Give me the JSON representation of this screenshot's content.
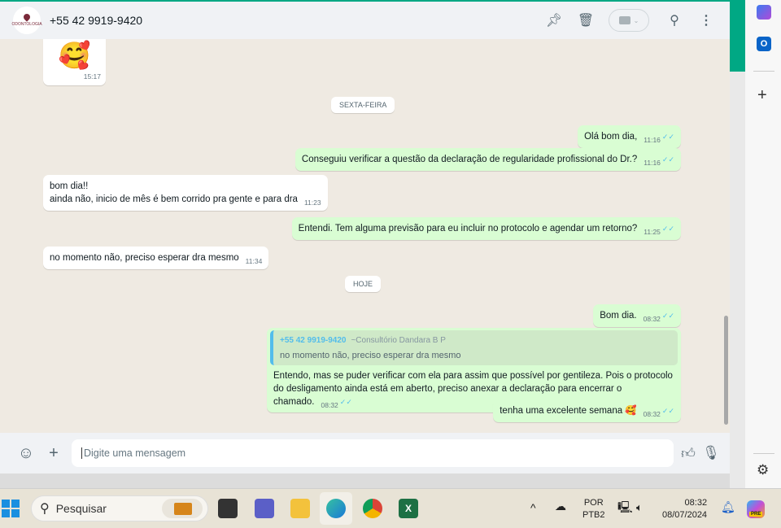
{
  "header": {
    "contact": "+55 42 9919-9420",
    "avatar_text": "ODONTOLOGIA",
    "icons": [
      "pin-icon",
      "trash-icon",
      "video-call-icon",
      "search-icon",
      "menu-icon"
    ]
  },
  "messages": [
    {
      "dir": "in",
      "text": "🥰",
      "time": "15:17"
    },
    {
      "type": "day",
      "text": "SEXTA-FEIRA"
    },
    {
      "dir": "out",
      "text": "Olá bom dia,",
      "time": "11:16"
    },
    {
      "dir": "out",
      "text": "Conseguiu verificar a questão da declaração de regularidade profissional do Dr.?",
      "time": "11:16"
    },
    {
      "dir": "in",
      "text": "bom dia!!",
      "text2": "ainda não, inicio de mês é bem corrido pra gente e para dra",
      "time": "11:23"
    },
    {
      "dir": "out",
      "text": "Entendi. Tem alguma previsão para eu incluir no protocolo e agendar um retorno?",
      "time": "11:25"
    },
    {
      "dir": "in",
      "text": "no momento não, preciso esperar dra mesmo",
      "time": "11:34"
    },
    {
      "type": "day",
      "text": "HOJE"
    },
    {
      "dir": "out",
      "text": "Bom dia.",
      "time": "08:32"
    },
    {
      "dir": "out",
      "quote_name": "+55 42 9919-9420",
      "quote_sub": "~Consultório Dandara B P",
      "quote_text": "no momento não, preciso esperar dra mesmo",
      "text": "Entendo, mas se puder verificar com ela para assim que possível por gentileza. Pois o protocolo do desligamento ainda está em aberto, preciso anexar a declaração para encerrar o chamado.",
      "time": "08:32"
    },
    {
      "dir": "out",
      "text": "tenha uma excelente semana 🥰",
      "time": "08:32"
    }
  ],
  "ticks": "✓✓",
  "footer": {
    "placeholder": "Digite uma mensagem"
  },
  "taskbar": {
    "search": "Pesquisar",
    "lang1": "POR",
    "lang2": "PTB2",
    "time": "08:32",
    "date": "08/07/2024",
    "copilot_badge": "PRE"
  },
  "colors": {
    "accent": "#00a884",
    "outgoing": "#d9fdd3",
    "tick": "#53bdeb"
  }
}
